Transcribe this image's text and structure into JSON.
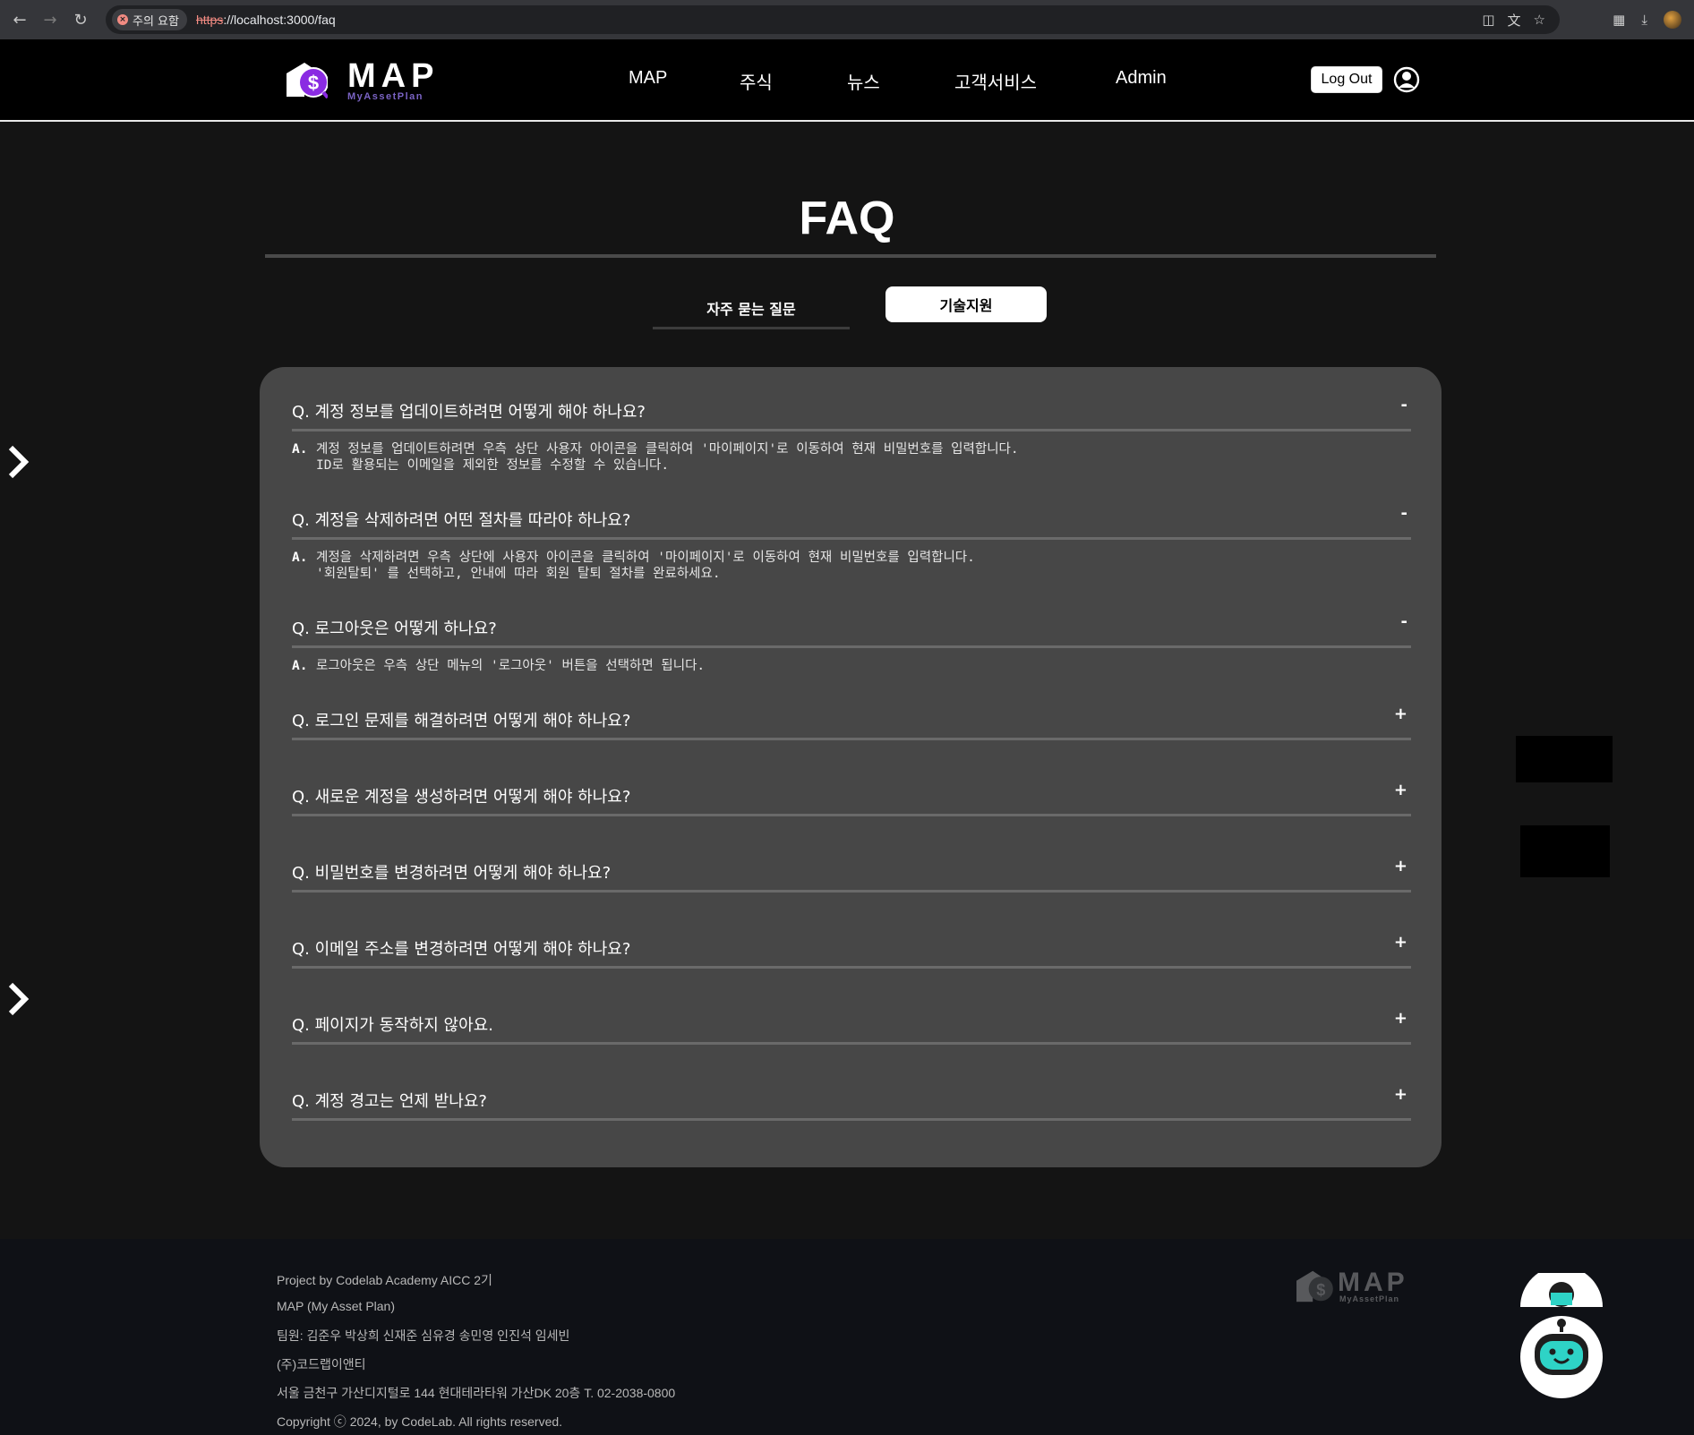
{
  "browser": {
    "warning_label": "주의 요함",
    "url_scheme": "https",
    "url_rest": "://localhost:3000/faq"
  },
  "header": {
    "logo_text": "MAP",
    "logo_subtext": "MyAssetPlan",
    "nav": [
      "MAP",
      "주식",
      "뉴스",
      "고객서비스",
      "Admin"
    ],
    "logout_label": "Log Out"
  },
  "page": {
    "title": "FAQ",
    "tabs": {
      "faq": "자주 묻는 질문",
      "tech": "기술지원"
    }
  },
  "faq": {
    "items": [
      {
        "q": "Q. 계정 정보를 업데이트하려면 어떻게 해야 하나요?",
        "toggle": "-",
        "a_label": "A.",
        "a": "계정 정보를 업데이트하려면 우측 상단 사용자 아이콘을 클릭하여 '마이페이지'로 이동하여 현재 비밀번호를 입력합니다.\nID로 활용되는 이메일을 제외한 정보를 수정할 수 있습니다."
      },
      {
        "q": "Q. 계정을 삭제하려면 어떤 절차를 따라야 하나요?",
        "toggle": "-",
        "a_label": "A.",
        "a": "계정을 삭제하려면 우측 상단에 사용자 아이콘을 클릭하여 '마이페이지'로 이동하여 현재 비밀번호를 입력합니다.\n'회원탈퇴' 를 선택하고, 안내에 따라 회원 탈퇴 절차를 완료하세요."
      },
      {
        "q": "Q. 로그아웃은 어떻게 하나요?",
        "toggle": "-",
        "a_label": "A.",
        "a": "로그아웃은 우측 상단 메뉴의 '로그아웃' 버튼을 선택하면 됩니다."
      },
      {
        "q": "Q. 로그인 문제를 해결하려면 어떻게 해야 하나요?",
        "toggle": "+"
      },
      {
        "q": "Q. 새로운 계정을 생성하려면 어떻게 해야 하나요?",
        "toggle": "+"
      },
      {
        "q": "Q. 비밀번호를 변경하려면 어떻게 해야 하나요?",
        "toggle": "+"
      },
      {
        "q": "Q. 이메일 주소를 변경하려면 어떻게 해야 하나요?",
        "toggle": "+"
      },
      {
        "q": "Q. 페이지가 동작하지 않아요.",
        "toggle": "+"
      },
      {
        "q": "Q. 계정 경고는 언제 받나요?",
        "toggle": "+"
      }
    ]
  },
  "footer": {
    "lines": [
      "Project by Codelab Academy AICC 2기",
      "MAP (My Asset Plan)",
      "팀원: 김준우 박상희 신재준 심유경 송민영 인진석 임세빈",
      "(주)코드랩이앤티",
      "서울 금천구 가산디지털로 144 현대테라타워 가산DK 20층 T. 02-2038-0800",
      "Copyright ⓒ 2024, by CodeLab. All rights reserved."
    ],
    "logo_text": "MAP",
    "logo_subtext": "MyAssetPlan"
  },
  "colors": {
    "accent_purple": "#8a2be2",
    "panel": "#474747",
    "background": "#141414"
  },
  "icons": [
    "back-icon",
    "forward-icon",
    "reload-icon",
    "warning-icon",
    "install-icon",
    "translate-icon",
    "star-icon",
    "extensions-icon",
    "download-icon",
    "user-icon",
    "chevron-right-icon",
    "chatbot-icon"
  ]
}
